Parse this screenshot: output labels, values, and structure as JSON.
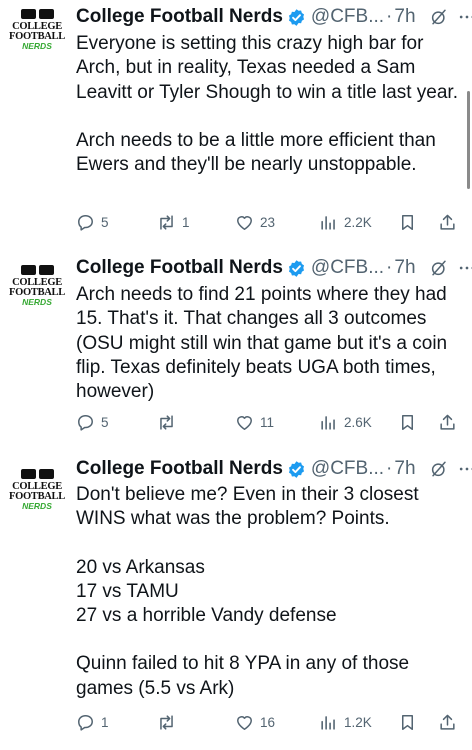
{
  "account": {
    "name": "College Football Nerds",
    "handle": "@CFB...",
    "separator": "·",
    "avatar_text": [
      "COLLEGE",
      "FOOTBALL",
      "NERDS"
    ]
  },
  "colors": {
    "verified": "#1d9bf0",
    "muted": "#536471",
    "text": "#0f1419",
    "avatar_accent": "#35a832"
  },
  "tweets": [
    {
      "time": "7h",
      "paragraphs": [
        "Everyone is setting this crazy high bar for Arch, but in reality, Texas needed a Sam Leavitt or Tyler Shough to win a title last year.",
        "Arch needs to be a little more efficient than Ewers and they'll be nearly unstoppable."
      ],
      "stats": {
        "replies": "5",
        "reposts": "1",
        "likes": "23",
        "views": "2.2K"
      }
    },
    {
      "time": "7h",
      "paragraphs": [
        "Arch needs to find 21 points where they had 15. That's it. That changes all 3 outcomes (OSU might still win that game but it's a coin flip. Texas definitely beats UGA both times, however)"
      ],
      "stats": {
        "replies": "5",
        "reposts": "",
        "likes": "11",
        "views": "2.6K"
      }
    },
    {
      "time": "7h",
      "paragraphs": [
        "Don't believe me? Even in their 3 closest WINS what was the problem? Points.",
        "20 vs Arkansas\n17 vs TAMU\n27 vs a horrible Vandy defense",
        "Quinn failed to hit 8 YPA in any of those games (5.5 vs Ark)"
      ],
      "stats": {
        "replies": "1",
        "reposts": "",
        "likes": "16",
        "views": "1.2K"
      }
    }
  ]
}
